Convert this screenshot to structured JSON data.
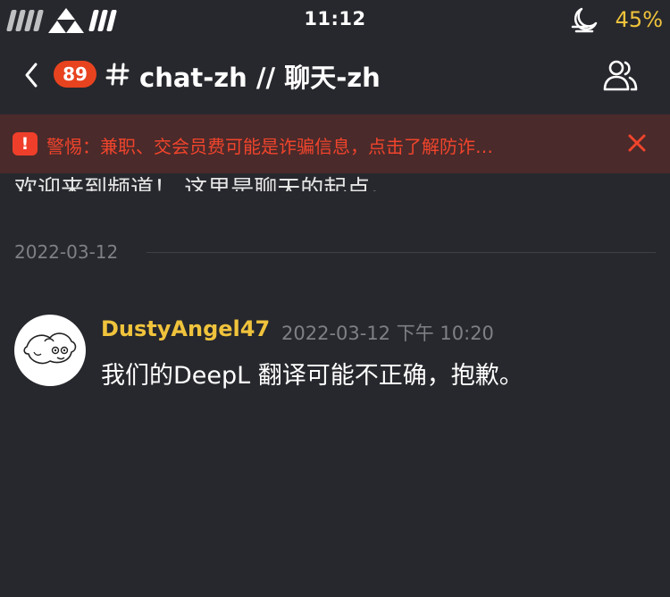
{
  "status_bar": {
    "time": "11:12",
    "battery": "45%",
    "battery_color": "#f0c33c"
  },
  "header": {
    "unread_count": "89",
    "channel_title": "chat-zh // 聊天-zh",
    "icons": [
      "back-chevron-icon",
      "hash-icon",
      "members-icon"
    ]
  },
  "warning": {
    "text": "警惕：兼职、交会员费可能是诈骗信息，点击了解防诈…",
    "icon_glyph": "!",
    "color": "#f0442c"
  },
  "welcome_line": "欢迎来到频道！ 这里是聊天的起点。",
  "date_divider": "2022-03-12",
  "message": {
    "author": "DustyAngel47",
    "author_color": "#f0c33c",
    "timestamp": "2022-03-12 下午 10:20",
    "text": "我们的DeepL 翻译可能不正确，抱歉。"
  }
}
